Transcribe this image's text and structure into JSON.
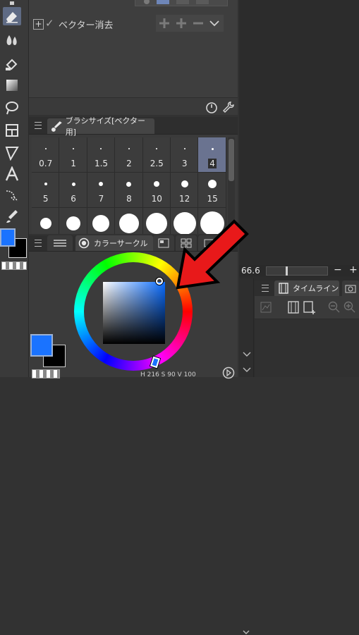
{
  "layer_panel": {
    "row_label": "ベクター消去",
    "toggle_plus": "+",
    "check": "✓"
  },
  "brush_size_panel": {
    "tab_label": "ブラシサイズ[ベクター用]",
    "sizes": [
      "0.7",
      "1",
      "1.5",
      "2",
      "2.5",
      "3",
      "4",
      "5",
      "6",
      "7",
      "8",
      "10",
      "12",
      "15",
      "",
      "",
      "",
      "",
      "",
      "",
      ""
    ],
    "selected_index": 6
  },
  "color_panel": {
    "tab_label": "カラーサークル",
    "hsv_readout": "H 216 S 90 V 100",
    "main_color": "#1a73ff",
    "sub_color": "#000000"
  },
  "right_panel": {
    "zoom_value": "66.6",
    "minus": "−",
    "plus": "+",
    "timeline_tab": "タイムライン"
  },
  "annotation": {
    "arrow_color": "#e8191a"
  }
}
